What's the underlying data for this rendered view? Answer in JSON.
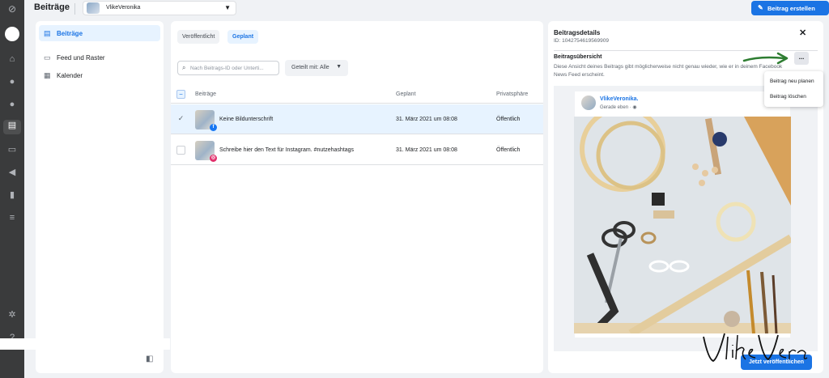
{
  "topbar": {
    "title": "Beiträge",
    "page_name": "VlikeVeronika",
    "create_button": "Beitrag erstellen"
  },
  "sidebar_nav": {
    "items": [
      {
        "label": "Beiträge",
        "icon": "posts-icon",
        "active": true
      },
      {
        "label": "Feed und Raster",
        "icon": "feed-grid-icon",
        "active": false
      },
      {
        "label": "Kalender",
        "icon": "calendar-icon",
        "active": false
      }
    ]
  },
  "posts": {
    "tabs": [
      {
        "label": "Veröffentlicht",
        "active": false
      },
      {
        "label": "Geplant",
        "active": true
      }
    ],
    "search_placeholder": "Nach Beitrags-ID oder Unterti...",
    "filter_label": "Geteilt mit: Alle",
    "columns": [
      "Beiträge",
      "Geplant",
      "Privatsphäre"
    ],
    "rows": [
      {
        "text": "Keine Bildunterschrift",
        "date": "31. März 2021 um 08:08",
        "privacy": "Öffentlich",
        "platform": "facebook",
        "selected": true
      },
      {
        "text": "Schreibe hier den Text für Instagram. #nutzehashtags",
        "date": "31. März 2021 um 08:08",
        "privacy": "Öffentlich",
        "platform": "instagram",
        "selected": false
      }
    ]
  },
  "details": {
    "title": "Beitragsdetails",
    "id_text": "ID: 1042754619569909",
    "overview_title": "Beitragsübersicht",
    "overview_desc": "Diese Ansicht deines Beitrags gibt möglicherweise nicht genau wieder, wie er in deinem Facebook News Feed erscheint.",
    "more_label": "...",
    "menu": [
      "Beitrag neu planen",
      "Beitrag löschen"
    ],
    "preview": {
      "name": "VlikeVeronika.",
      "time": "Gerade eben · "
    },
    "publish_button": "Jetzt veröffentlichen"
  },
  "colors": {
    "accent": "#1b74e4",
    "rail": "#3a3b3c",
    "background": "#f0f2f5",
    "selected_row": "#e7f3ff",
    "annotation_arrow": "#2e7d32"
  }
}
